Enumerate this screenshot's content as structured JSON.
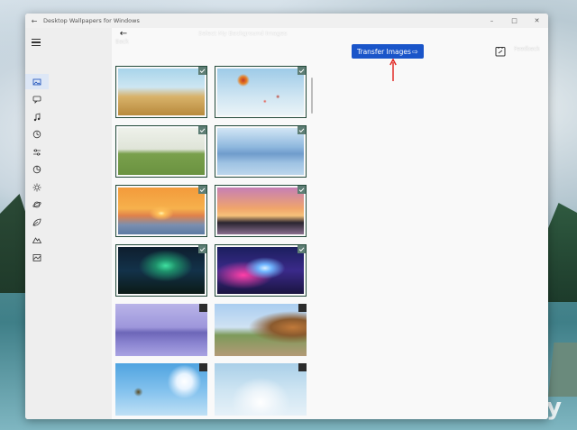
{
  "window": {
    "title": "Desktop Wallpapers for Windows"
  },
  "header": {
    "back_label": "Back",
    "title": "Select My Background Images",
    "transfer_button_label": "Transfer Images",
    "feedback_label": "Feedback"
  },
  "sidebar": {
    "icons": [
      "image-icon",
      "chat-icon",
      "music-icon",
      "clock-icon",
      "settings-sliders-icon",
      "chart-icon",
      "sun-icon",
      "planet-icon",
      "leaf-icon",
      "mountain-icon",
      "landscape-icon"
    ],
    "active_index": 0
  },
  "thumbnails": [
    {
      "name": "wheat-field",
      "selected": true
    },
    {
      "name": "hot-air-balloons",
      "selected": true
    },
    {
      "name": "countryside-road",
      "selected": true
    },
    {
      "name": "misty-mountains",
      "selected": true
    },
    {
      "name": "ocean-sunset",
      "selected": true
    },
    {
      "name": "city-skyline-sunset",
      "selected": true
    },
    {
      "name": "aurora",
      "selected": true
    },
    {
      "name": "cosmic-planet",
      "selected": true
    },
    {
      "name": "purple-lake",
      "selected": false
    },
    {
      "name": "autumn-road",
      "selected": false
    },
    {
      "name": "blue-sky-plane",
      "selected": false
    },
    {
      "name": "sky-clouds",
      "selected": false
    }
  ],
  "colors": {
    "accent": "#1a55c9",
    "annotation": "#e0201b"
  }
}
